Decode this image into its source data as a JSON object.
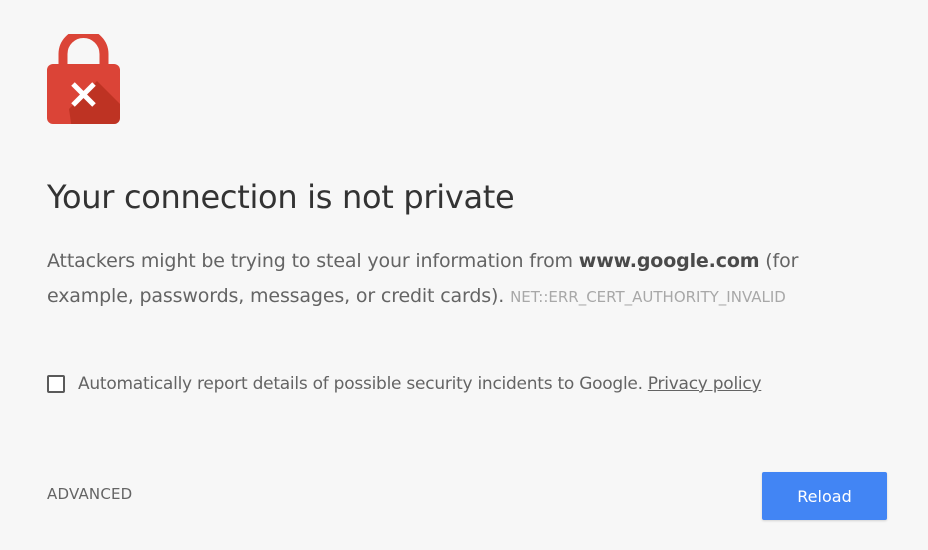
{
  "page": {
    "background": "#f7f7f7",
    "icon": "lock-error-icon"
  },
  "heading": "Your connection is not private",
  "message": {
    "before_domain": "Attackers might be trying to steal your information from ",
    "domain": "www.google.com",
    "after_domain": " (for example, passwords, messages, or credit cards). ",
    "error_code": "NET::ERR_CERT_AUTHORITY_INVALID"
  },
  "report": {
    "checked": false,
    "label": "Automatically report details of possible security incidents to Google.",
    "link": "Privacy policy"
  },
  "buttons": {
    "advanced": "ADVANCED",
    "reload": "Reload"
  },
  "colors": {
    "lock_red": "#db4437",
    "lock_shadow": "#a52714",
    "reload_blue": "#4285f4"
  }
}
